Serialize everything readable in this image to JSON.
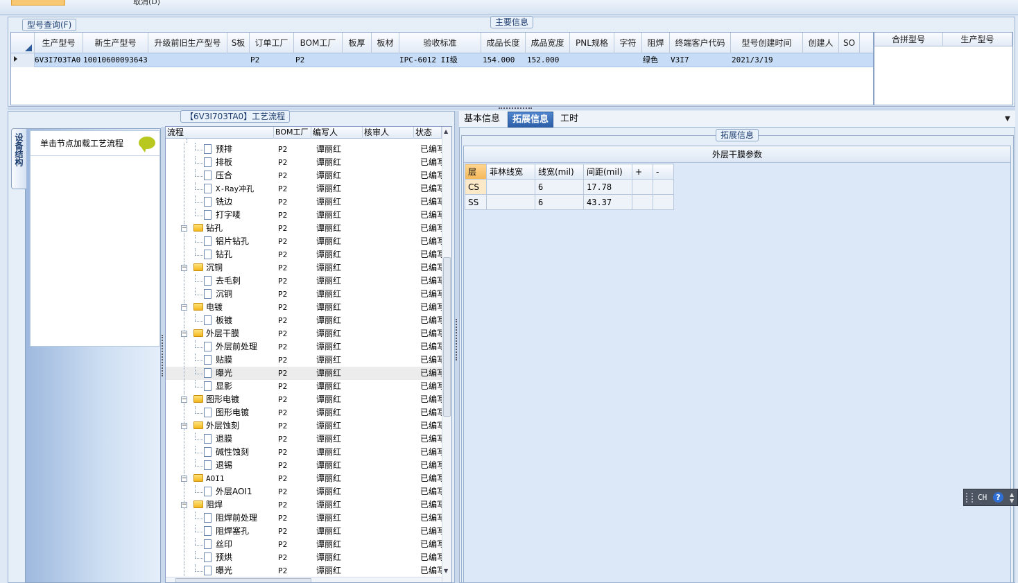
{
  "top": {
    "cut_text": "取消(D)"
  },
  "main_info": {
    "caption": "主要信息",
    "query_caption": "型号查询(F)",
    "columns": [
      "生产型号",
      "新生产型号",
      "升级前旧生产型号",
      "S板",
      "订单工厂",
      "BOM工厂",
      "板厚",
      "板材",
      "验收标准",
      "成品长度",
      "成品宽度",
      "PNL规格",
      "字符",
      "阻焊",
      "终端客户代码",
      "型号创建时间",
      "创建人",
      "SO"
    ],
    "row": {
      "model": "6V3I703TA0",
      "new_model": "10010600093643",
      "old_model": "",
      "s_board": "",
      "order_factory": "P2",
      "bom_factory": "P2",
      "thickness": "",
      "material": "",
      "standard": "IPC-6012 II级",
      "length": "154.000",
      "width": "152.000",
      "pnl": "",
      "char": "",
      "solder": "绿色",
      "customer": "V3I7",
      "created": "2021/3/19",
      "creator": "",
      "so": ""
    },
    "side_columns": [
      "合拼型号",
      "生产型号"
    ]
  },
  "process": {
    "caption": "【6V3I703TA0】工艺流程",
    "side_tab": "设备结构",
    "hint": "单击节点加载工艺流程",
    "columns": [
      "流程",
      "BOM工厂",
      "编写人",
      "核审人",
      "状态"
    ],
    "rows": [
      {
        "kind": "doc",
        "name": "预排",
        "bom": "P2",
        "writer": "谭丽红",
        "reviewer": "",
        "status": "已编写"
      },
      {
        "kind": "doc",
        "name": "排板",
        "bom": "P2",
        "writer": "谭丽红",
        "reviewer": "",
        "status": "已编写"
      },
      {
        "kind": "doc",
        "name": "压合",
        "bom": "P2",
        "writer": "谭丽红",
        "reviewer": "",
        "status": "已编写"
      },
      {
        "kind": "doc",
        "name": "X-Ray冲孔",
        "bom": "P2",
        "writer": "谭丽红",
        "reviewer": "",
        "status": "已编写"
      },
      {
        "kind": "doc",
        "name": "铣边",
        "bom": "P2",
        "writer": "谭丽红",
        "reviewer": "",
        "status": "已编写"
      },
      {
        "kind": "doc",
        "name": "打字唛",
        "bom": "P2",
        "writer": "谭丽红",
        "reviewer": "",
        "status": "已编写"
      },
      {
        "kind": "folder",
        "name": "钻孔",
        "bom": "P2",
        "writer": "谭丽红",
        "reviewer": "",
        "status": "已编写"
      },
      {
        "kind": "doc",
        "name": "铝片钻孔",
        "bom": "P2",
        "writer": "谭丽红",
        "reviewer": "",
        "status": "已编写"
      },
      {
        "kind": "doc",
        "name": "钻孔",
        "bom": "P2",
        "writer": "谭丽红",
        "reviewer": "",
        "status": "已编写"
      },
      {
        "kind": "folder",
        "name": "沉铜",
        "bom": "P2",
        "writer": "谭丽红",
        "reviewer": "",
        "status": "已编写"
      },
      {
        "kind": "doc",
        "name": "去毛刺",
        "bom": "P2",
        "writer": "谭丽红",
        "reviewer": "",
        "status": "已编写"
      },
      {
        "kind": "doc",
        "name": "沉铜",
        "bom": "P2",
        "writer": "谭丽红",
        "reviewer": "",
        "status": "已编写"
      },
      {
        "kind": "folder",
        "name": "电镀",
        "bom": "P2",
        "writer": "谭丽红",
        "reviewer": "",
        "status": "已编写"
      },
      {
        "kind": "doc",
        "name": "板镀",
        "bom": "P2",
        "writer": "谭丽红",
        "reviewer": "",
        "status": "已编写"
      },
      {
        "kind": "folder",
        "name": "外层干膜",
        "bom": "P2",
        "writer": "谭丽红",
        "reviewer": "",
        "status": "已编写"
      },
      {
        "kind": "doc",
        "name": "外层前处理",
        "bom": "P2",
        "writer": "谭丽红",
        "reviewer": "",
        "status": "已编写"
      },
      {
        "kind": "doc",
        "name": "贴膜",
        "bom": "P2",
        "writer": "谭丽红",
        "reviewer": "",
        "status": "已编写"
      },
      {
        "kind": "doc",
        "name": "曝光",
        "bom": "P2",
        "writer": "谭丽红",
        "reviewer": "",
        "status": "已编写",
        "selected": true
      },
      {
        "kind": "doc",
        "name": "显影",
        "bom": "P2",
        "writer": "谭丽红",
        "reviewer": "",
        "status": "已编写"
      },
      {
        "kind": "folder",
        "name": "图形电镀",
        "bom": "P2",
        "writer": "谭丽红",
        "reviewer": "",
        "status": "已编写"
      },
      {
        "kind": "doc",
        "name": "图形电镀",
        "bom": "P2",
        "writer": "谭丽红",
        "reviewer": "",
        "status": "已编写"
      },
      {
        "kind": "folder",
        "name": "外层蚀刻",
        "bom": "P2",
        "writer": "谭丽红",
        "reviewer": "",
        "status": "已编写"
      },
      {
        "kind": "doc",
        "name": "退膜",
        "bom": "P2",
        "writer": "谭丽红",
        "reviewer": "",
        "status": "已编写"
      },
      {
        "kind": "doc",
        "name": "碱性蚀刻",
        "bom": "P2",
        "writer": "谭丽红",
        "reviewer": "",
        "status": "已编写"
      },
      {
        "kind": "doc",
        "name": "退锡",
        "bom": "P2",
        "writer": "谭丽红",
        "reviewer": "",
        "status": "已编写"
      },
      {
        "kind": "folder",
        "name": "AOI1",
        "bom": "P2",
        "writer": "谭丽红",
        "reviewer": "",
        "status": "已编写"
      },
      {
        "kind": "doc",
        "name": "外层AOI1",
        "bom": "P2",
        "writer": "谭丽红",
        "reviewer": "",
        "status": "已编写"
      },
      {
        "kind": "folder",
        "name": "阻焊",
        "bom": "P2",
        "writer": "谭丽红",
        "reviewer": "",
        "status": "已编写"
      },
      {
        "kind": "doc",
        "name": "阻焊前处理",
        "bom": "P2",
        "writer": "谭丽红",
        "reviewer": "",
        "status": "已编写"
      },
      {
        "kind": "doc",
        "name": "阻焊塞孔",
        "bom": "P2",
        "writer": "谭丽红",
        "reviewer": "",
        "status": "已编写"
      },
      {
        "kind": "doc",
        "name": "丝印",
        "bom": "P2",
        "writer": "谭丽红",
        "reviewer": "",
        "status": "已编写"
      },
      {
        "kind": "doc",
        "name": "预烘",
        "bom": "P2",
        "writer": "谭丽红",
        "reviewer": "",
        "status": "已编写"
      },
      {
        "kind": "doc",
        "name": "曝光",
        "bom": "P2",
        "writer": "谭丽红",
        "reviewer": "",
        "status": "已编写"
      }
    ]
  },
  "tabs": [
    {
      "label": "基本信息",
      "active": false
    },
    {
      "label": "拓展信息",
      "active": true
    },
    {
      "label": "工时",
      "active": false
    }
  ],
  "ext": {
    "caption": "拓展信息",
    "section_title": "外层干膜参数",
    "columns": [
      "层",
      "菲林线宽",
      "线宽(mil)",
      "间距(mil)",
      "+",
      "-"
    ],
    "rows": [
      {
        "layer": "CS",
        "film": "",
        "line": "6",
        "space": "17.78"
      },
      {
        "layer": "SS",
        "film": "",
        "line": "6",
        "space": "43.37"
      }
    ]
  },
  "ime": {
    "label": "CH",
    "help": "?"
  }
}
